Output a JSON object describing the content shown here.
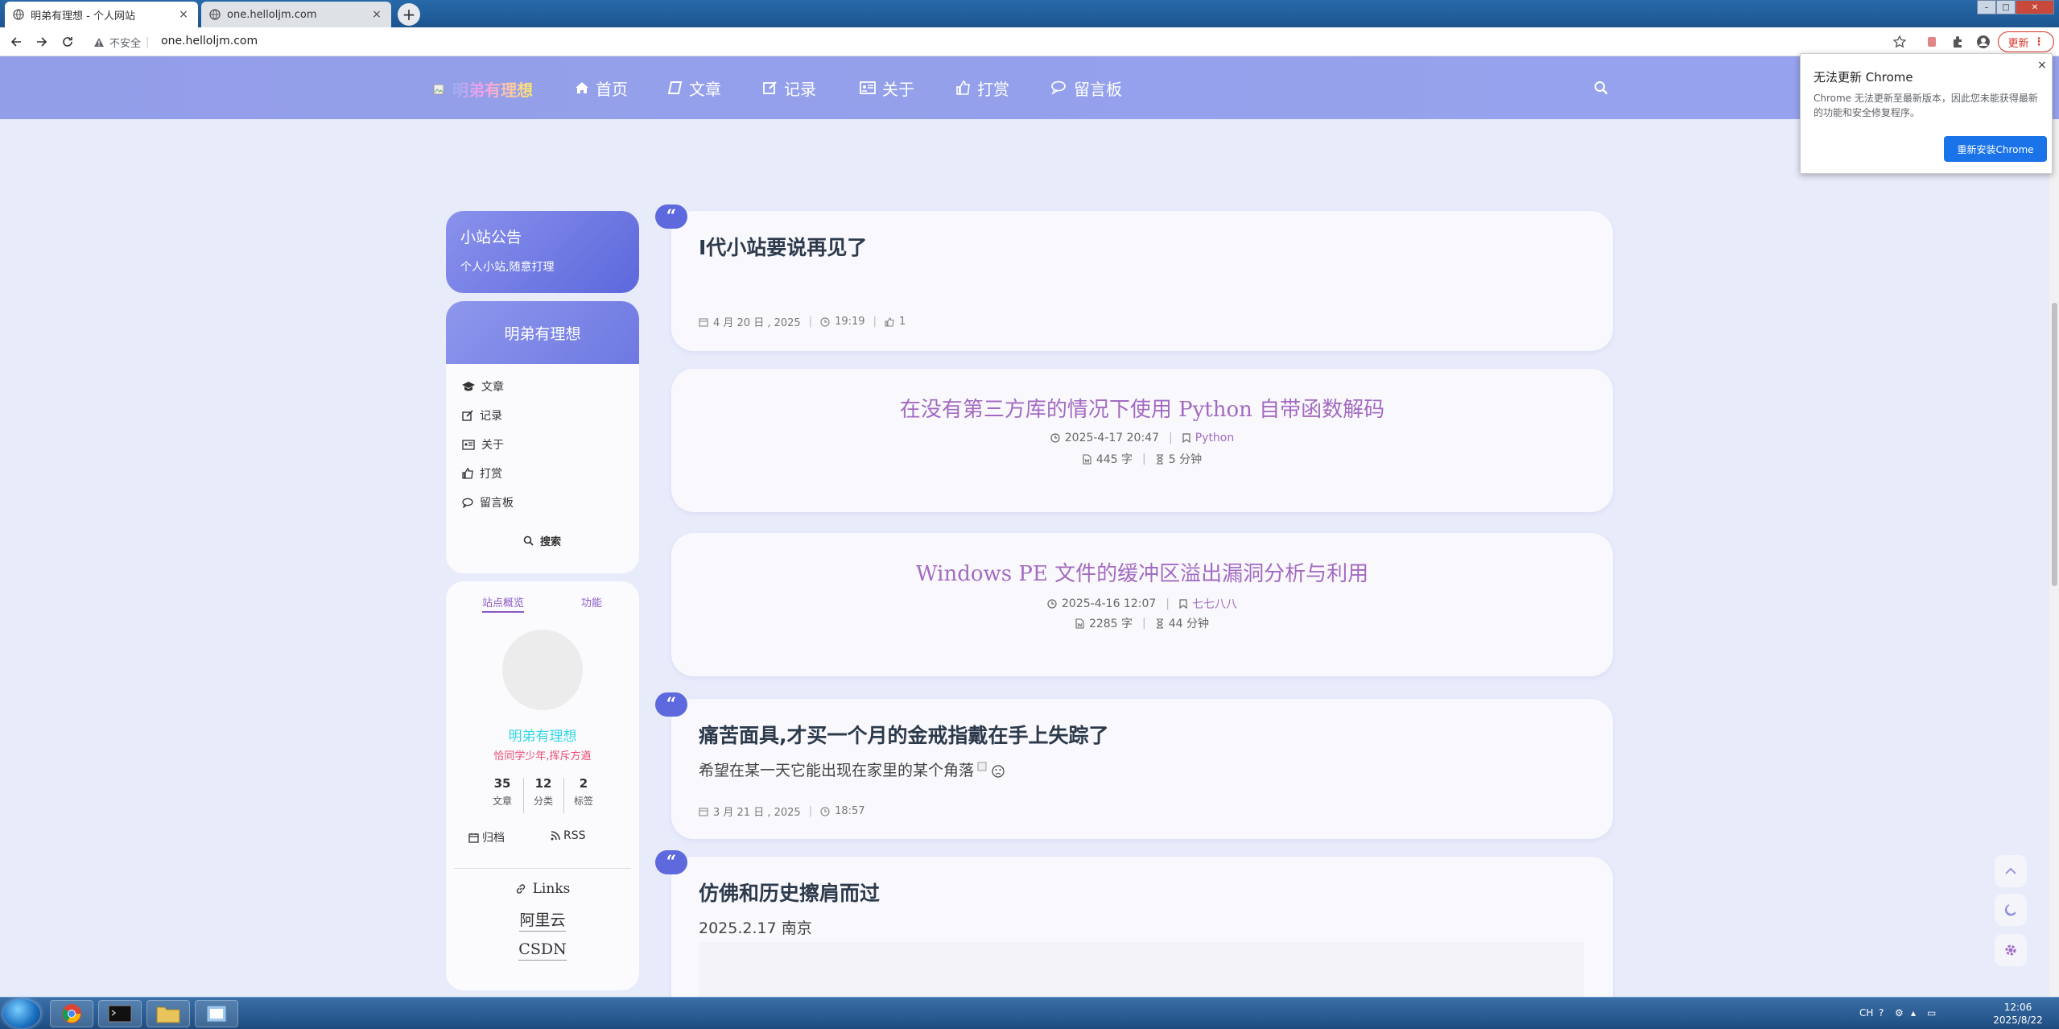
{
  "browser": {
    "tabs": [
      {
        "title": "明弟有理想 - 个人网站",
        "close": "×"
      },
      {
        "title": "one.helloljm.com",
        "close": "×"
      }
    ],
    "new_tab": "+",
    "insecure_label": "不安全",
    "url": "one.helloljm.com",
    "update_label": "更新"
  },
  "site": {
    "logo_text": "明弟有理想",
    "nav": [
      {
        "label": "首页",
        "icon": "home-icon"
      },
      {
        "label": "文章",
        "icon": "book-icon"
      },
      {
        "label": "记录",
        "icon": "edit-icon"
      },
      {
        "label": "关于",
        "icon": "id-card-icon"
      },
      {
        "label": "打赏",
        "icon": "thumbs-up-icon"
      },
      {
        "label": "留言板",
        "icon": "comments-icon"
      }
    ]
  },
  "sidebar": {
    "notice": {
      "title": "小站公告",
      "text": "个人小站,随意打理"
    },
    "menu": {
      "title": "明弟有理想",
      "items": [
        {
          "label": "文章",
          "icon": "graduation-cap-icon"
        },
        {
          "label": "记录",
          "icon": "edit-icon"
        },
        {
          "label": "关于",
          "icon": "id-card-icon"
        },
        {
          "label": "打赏",
          "icon": "thumbs-up-icon"
        },
        {
          "label": "留言板",
          "icon": "comments-icon"
        }
      ],
      "search_label": "搜索"
    },
    "profile": {
      "tabs": [
        "站点概览",
        "功能"
      ],
      "name": "明弟有理想",
      "motto": "恰同学少年,挥斥方遒",
      "stats": [
        {
          "value": "35",
          "label": "文章"
        },
        {
          "value": "12",
          "label": "分类"
        },
        {
          "value": "2",
          "label": "标签"
        }
      ],
      "archive_label": "归档",
      "rss_label": "RSS",
      "links_title": "Links",
      "links": [
        "阿里云",
        "CSDN"
      ]
    }
  },
  "posts": [
    {
      "type": "moment",
      "title": "Ⅰ代小站要说再见了",
      "date": "4 月 20 日 , 2025",
      "time": "19:19",
      "likes": "1"
    },
    {
      "type": "article",
      "title": "在没有第三方库的情况下使用 Python 自带函数解码",
      "datetime": "2025-4-17 20:47",
      "category": "Python",
      "words": "445 字",
      "read_time": "5 分钟"
    },
    {
      "type": "article",
      "title": "Windows PE 文件的缓冲区溢出漏洞分析与利用",
      "datetime": "2025-4-16 12:07",
      "category": "七七八八",
      "words": "2285 字",
      "read_time": "44 分钟"
    },
    {
      "type": "moment",
      "title": "痛苦面具,才买一个月的金戒指戴在手上失踪了",
      "body": "希望在某一天它能出现在家里的某个角落",
      "date": "3 月 21 日 , 2025",
      "time": "18:57"
    },
    {
      "type": "moment",
      "title": "仿佛和历史擦肩而过",
      "body": "2025.2.17 南京"
    }
  ],
  "quote_glyph": "“",
  "popup": {
    "title": "无法更新 Chrome",
    "body": "Chrome 无法更新至最新版本，因此您未能获得最新的功能和安全修复程序。",
    "button": "重新安装Chrome",
    "close": "×"
  },
  "taskbar": {
    "time": "12:06",
    "date": "2025/8/22",
    "lang": "CH"
  },
  "colors": {
    "accent": "#5d69dc",
    "header": "#939ee9",
    "link_purple": "#a36ac1",
    "page_bg": "#e8ebfa"
  }
}
